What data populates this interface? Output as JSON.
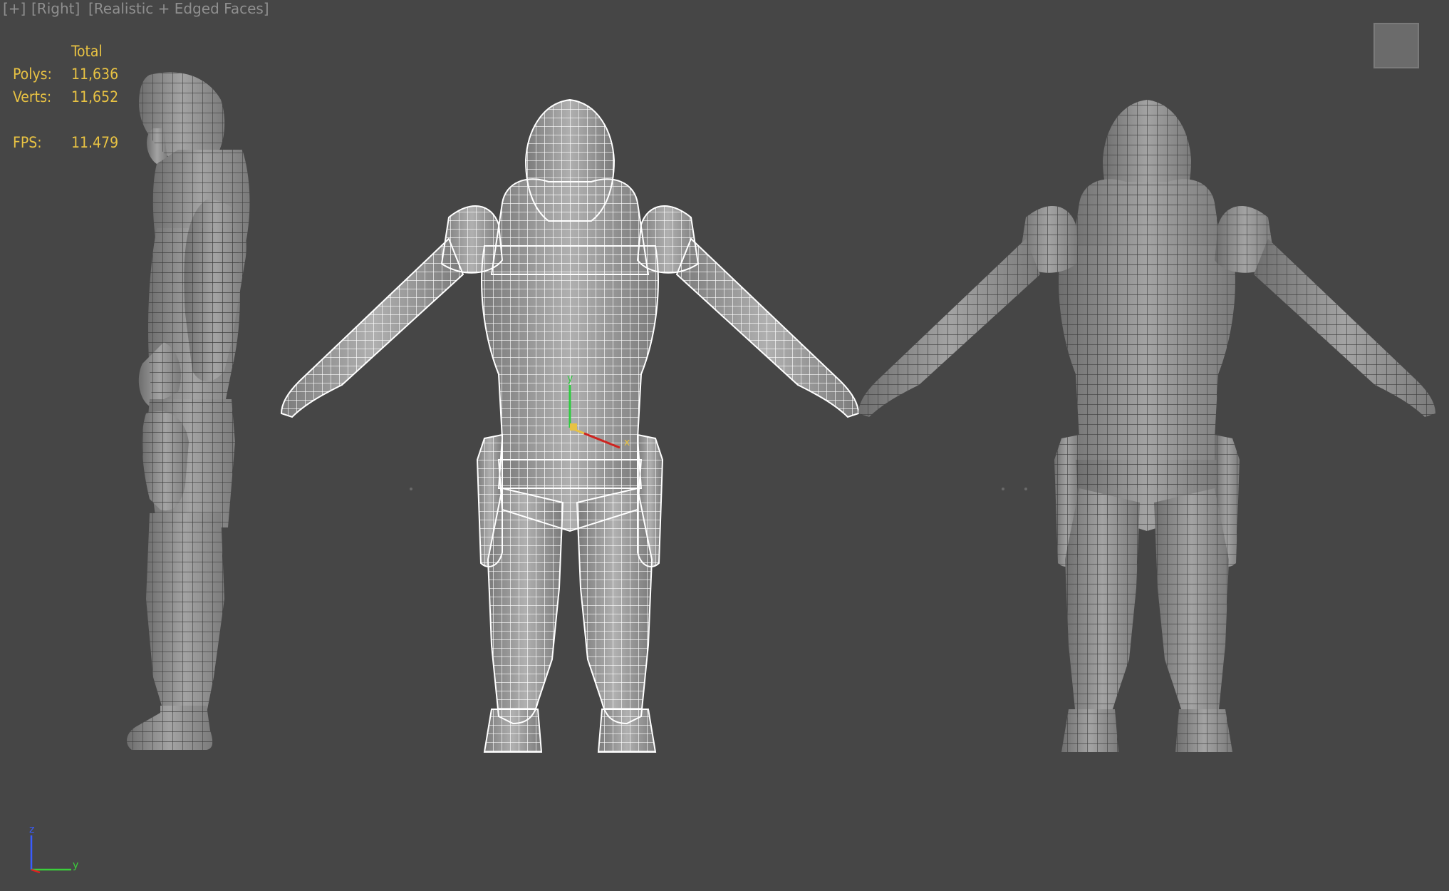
{
  "viewport": {
    "label_plus": "[+]",
    "label_view": "[Right]",
    "label_shading": "[Realistic + Edged Faces]"
  },
  "stats": {
    "header": "Total",
    "polys_label": "Polys:",
    "polys_value": "11,636",
    "verts_label": "Verts:",
    "verts_value": "11,652",
    "fps_label": "FPS:",
    "fps_value": "11.479"
  },
  "viewcube": {
    "icon": "viewcube-icon"
  },
  "axis_tripod": {
    "z_label": "z",
    "y_label": "y",
    "colors": {
      "z": "#3a5cff",
      "y": "#3bcf3b",
      "x": "#e02020"
    }
  },
  "transform_gizmo": {
    "y_label": "y",
    "x_label": "x",
    "colors": {
      "y": "#2ecc40",
      "x": "#e8c243",
      "red": "#cc2222"
    }
  },
  "colors": {
    "background": "#464646",
    "mesh_fill": "#8e8e8e",
    "wire_selected": "#ffffff",
    "wire_edges": "#3d3d3d",
    "stats_text": "#e8c243",
    "label_text": "#8f8f8f"
  }
}
